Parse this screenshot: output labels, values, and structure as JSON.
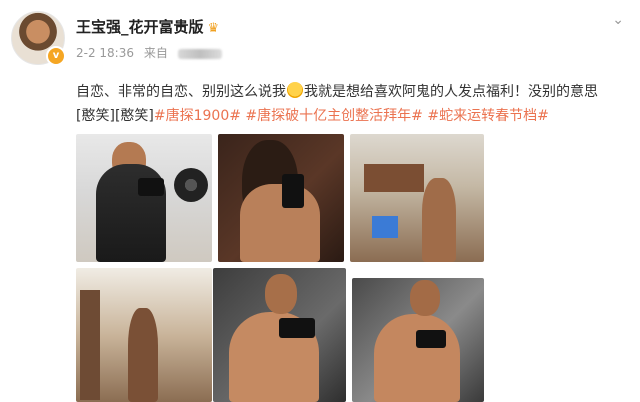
{
  "post": {
    "username": "王宝强_花开富贵版",
    "crown_icon": "crown-icon",
    "date": "2-2 18:36",
    "source_prefix": "来自",
    "content_text": "自恋、非常的自恋、别别这么说我",
    "content_text2": "我就是想给喜欢阿鬼的人发点福利！没别的意思",
    "emoji1": "[憨笑]",
    "emoji2": "[憨笑]",
    "hashtags": [
      "#唐探1900#",
      "#唐探破十亿主创整活拜年#",
      "#蛇来运转春节档#"
    ],
    "verified_badge": "v"
  },
  "photos": [
    {
      "name": "gym-selfie"
    },
    {
      "name": "long-hair-selfie-1"
    },
    {
      "name": "trailer-selfie-1"
    },
    {
      "name": "trailer-selfie-2"
    },
    {
      "name": "mirror-selfie-1"
    },
    {
      "name": "mirror-selfie-2"
    }
  ],
  "colors": {
    "hashtag": "#eb7350",
    "meta": "#999999"
  }
}
